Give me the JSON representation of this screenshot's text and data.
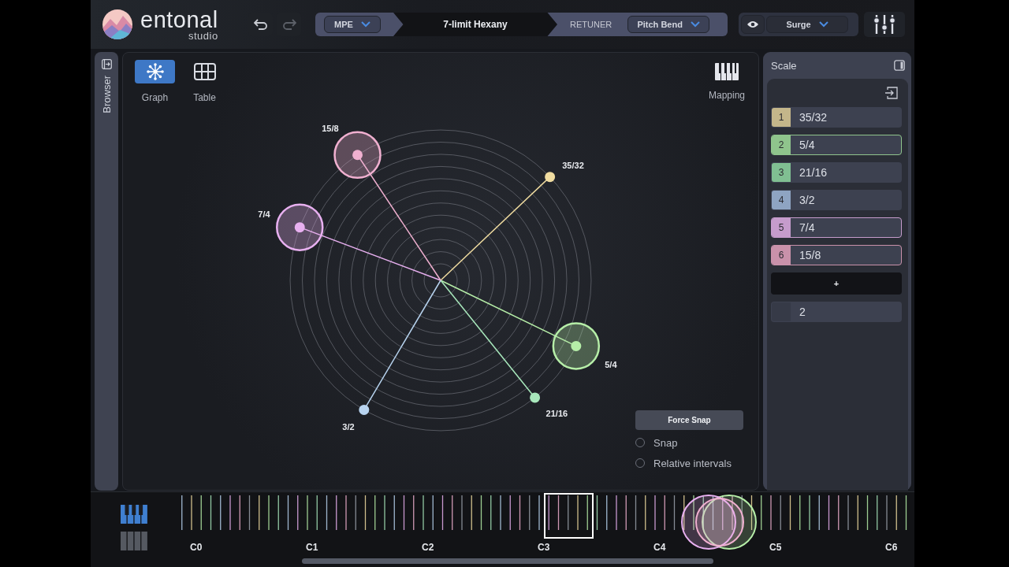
{
  "app": {
    "logo_word": "entonal",
    "logo_sub": "studio"
  },
  "history": {
    "undo_disabled": false,
    "redo_disabled": true
  },
  "chain": {
    "input_mode": "MPE",
    "scale_name": "7-limit Hexany",
    "retuner_label": "RETUNER",
    "retuner_mode": "Pitch Bend",
    "monitor_on": true,
    "synth": "Surge"
  },
  "browser": {
    "label": "Browser"
  },
  "views": [
    {
      "label": "Graph",
      "kind": "graph",
      "selected": true
    },
    {
      "label": "Table",
      "kind": "table",
      "selected": false
    }
  ],
  "mapping": {
    "label": "Mapping"
  },
  "graph": {
    "nodes": [
      {
        "label": "35/32",
        "color": "#f0dca0",
        "selected": false
      },
      {
        "label": "5/4",
        "color": "#b6eea8",
        "selected": true
      },
      {
        "label": "21/16",
        "color": "#a8e8bc",
        "selected": false
      },
      {
        "label": "3/2",
        "color": "#b8d4f0",
        "selected": false
      },
      {
        "label": "7/4",
        "color": "#e8b0f0",
        "selected": true
      },
      {
        "label": "15/8",
        "color": "#f0b0d0",
        "selected": true
      }
    ]
  },
  "snap": {
    "button": "Force Snap",
    "options": [
      {
        "label": "Snap",
        "checked": false
      },
      {
        "label": "Relative intervals",
        "checked": false
      }
    ]
  },
  "scale": {
    "title": "Scale",
    "intervals": [
      {
        "index": "1",
        "ratio": "35/32",
        "color": "#c4b68a",
        "selected": false
      },
      {
        "index": "2",
        "ratio": "5/4",
        "color": "#8fc48c",
        "selected": true
      },
      {
        "index": "3",
        "ratio": "21/16",
        "color": "#80bf92",
        "selected": false
      },
      {
        "index": "4",
        "ratio": "3/2",
        "color": "#8ea4c2",
        "selected": false
      },
      {
        "index": "5",
        "ratio": "7/4",
        "color": "#c69ccc",
        "selected": true
      },
      {
        "index": "6",
        "ratio": "15/8",
        "color": "#c991aa",
        "selected": true
      }
    ],
    "add_label": "+",
    "period": "2"
  },
  "keyboard": {
    "modes": [
      {
        "kind": "piano",
        "selected": true
      },
      {
        "kind": "grid",
        "selected": false
      }
    ],
    "octaves": [
      "C0",
      "C1",
      "C2",
      "C3",
      "C4",
      "C5",
      "C6"
    ]
  }
}
